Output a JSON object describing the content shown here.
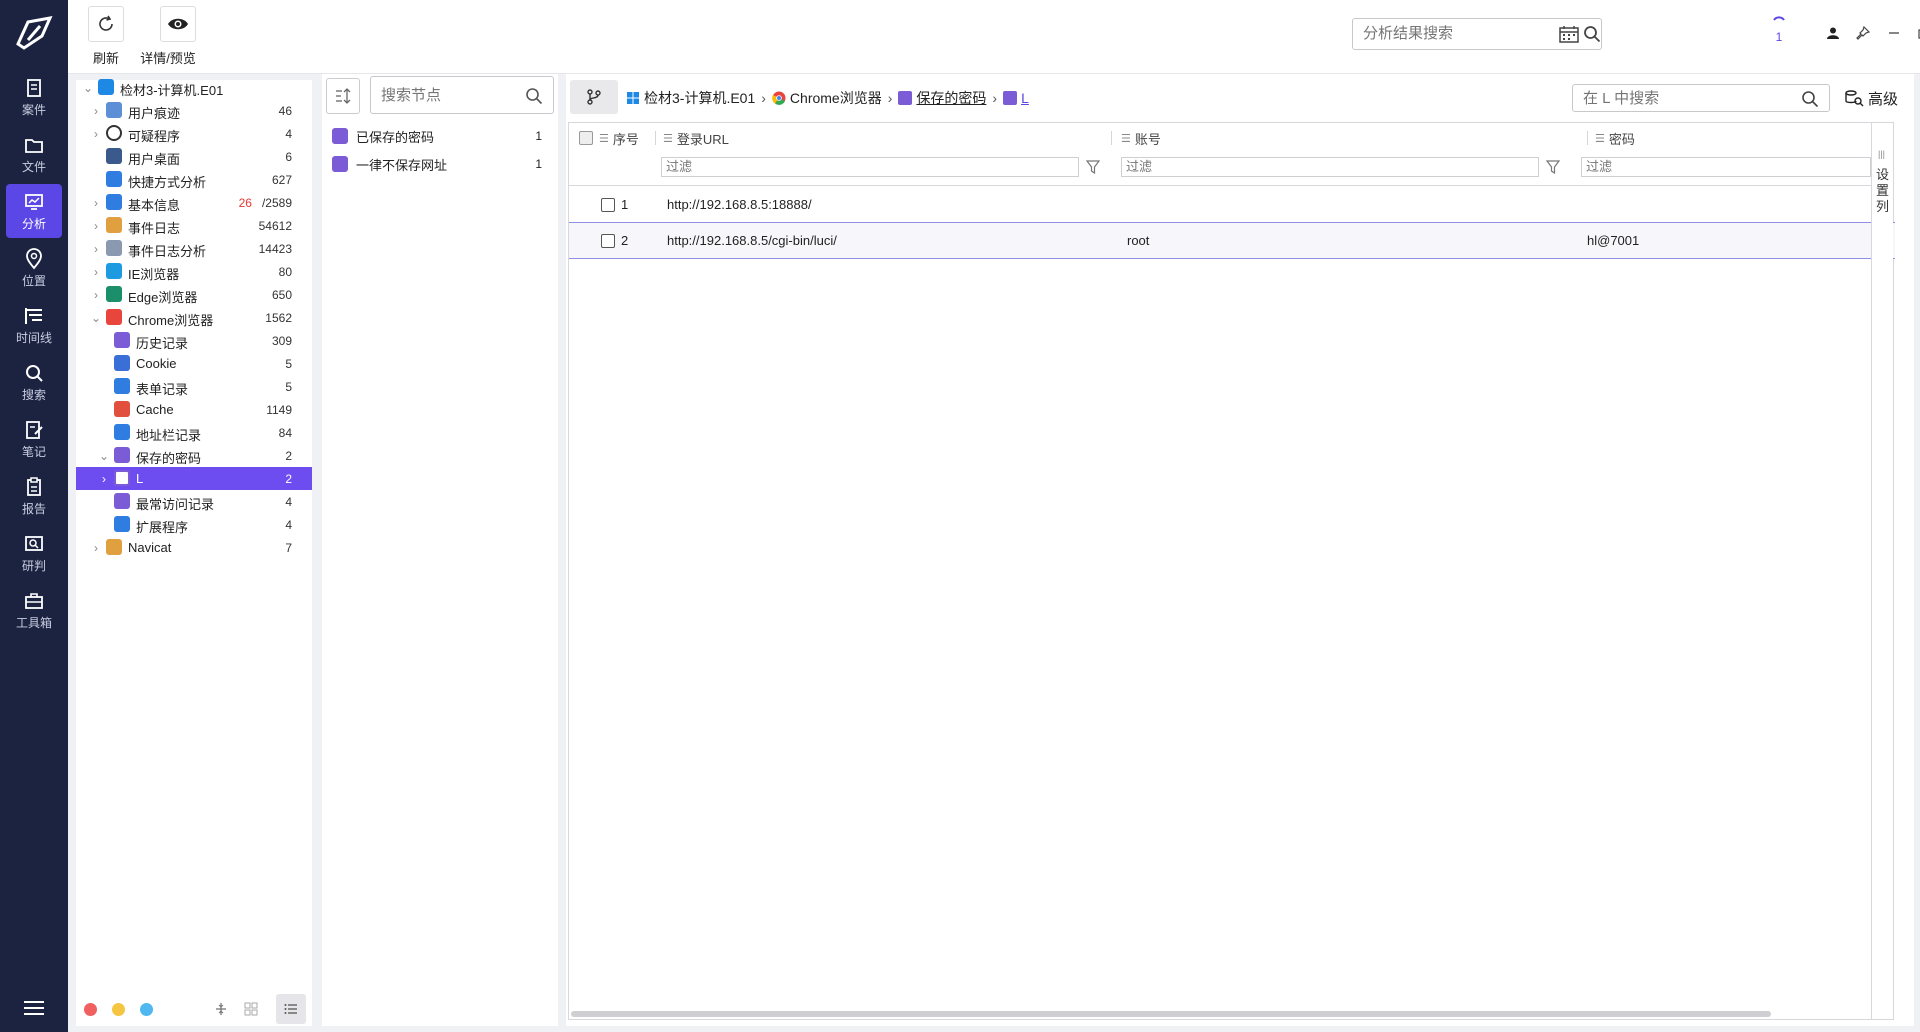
{
  "nav": {
    "items": [
      {
        "label": "案件",
        "icon": "case-icon"
      },
      {
        "label": "文件",
        "icon": "folder-icon"
      },
      {
        "label": "分析",
        "icon": "analysis-icon"
      },
      {
        "label": "位置",
        "icon": "location-pin-icon"
      },
      {
        "label": "时间线",
        "icon": "timeline-icon"
      },
      {
        "label": "搜索",
        "icon": "search-icon"
      },
      {
        "label": "笔记",
        "icon": "note-icon"
      },
      {
        "label": "报告",
        "icon": "report-icon"
      },
      {
        "label": "研判",
        "icon": "judgement-icon"
      },
      {
        "label": "工具箱",
        "icon": "toolbox-icon"
      }
    ],
    "active": "分析"
  },
  "toolbar": {
    "refresh_label": "刷新",
    "preview_label": "详情/预览",
    "search_placeholder": "分析结果搜索",
    "task_count": "1"
  },
  "tree": {
    "items": [
      {
        "label": "检材3-计算机.E01",
        "count": "",
        "icon": "windows-icon",
        "color": "#1e88e5"
      },
      {
        "label": "用户痕迹",
        "count": "46",
        "icon": "user-trace-icon",
        "color": "#5c8fd6"
      },
      {
        "label": "可疑程序",
        "count": "4",
        "icon": "magnifier-icon",
        "color": "#333333"
      },
      {
        "label": "用户桌面",
        "count": "6",
        "icon": "desktop-icon",
        "color": "#3a5a8c"
      },
      {
        "label": "快捷方式分析",
        "count": "627",
        "icon": "shortcut-icon",
        "color": "#2f7de1"
      },
      {
        "label": "基本信息",
        "count_red": "26",
        "count": "/2589",
        "icon": "info-icon",
        "color": "#2f7de1"
      },
      {
        "label": "事件日志",
        "count": "54612",
        "icon": "event-log-icon",
        "color": "#e0a040"
      },
      {
        "label": "事件日志分析",
        "count": "14423",
        "icon": "event-log-analysis-icon",
        "color": "#8a98b0"
      },
      {
        "label": "IE浏览器",
        "count": "80",
        "icon": "ie-icon",
        "color": "#1e9be0"
      },
      {
        "label": "Edge浏览器",
        "count": "650",
        "icon": "edge-icon",
        "color": "#1b8f6a"
      },
      {
        "label": "Chrome浏览器",
        "count": "1562",
        "icon": "chrome-icon",
        "color": "#e8453c"
      },
      {
        "label": "历史记录",
        "count": "309",
        "icon": "history-icon",
        "color": "#7b5cd6"
      },
      {
        "label": "Cookie",
        "count": "5",
        "icon": "cookie-icon",
        "color": "#3b6fd8"
      },
      {
        "label": "表单记录",
        "count": "5",
        "icon": "form-icon",
        "color": "#2f7de1"
      },
      {
        "label": "Cache",
        "count": "1149",
        "icon": "cache-icon",
        "color": "#e0503c"
      },
      {
        "label": "地址栏记录",
        "count": "84",
        "icon": "address-bar-icon",
        "color": "#2f7de1"
      },
      {
        "label": "保存的密码",
        "count": "2",
        "icon": "password-icon",
        "color": "#7b5cd6"
      },
      {
        "label": "L",
        "count": "2",
        "icon": "password-icon",
        "color": "#7b5cd6"
      },
      {
        "label": "最常访问记录",
        "count": "4",
        "icon": "most-visited-icon",
        "color": "#7b5cd6"
      },
      {
        "label": "扩展程序",
        "count": "4",
        "icon": "extension-icon",
        "color": "#2f7de1"
      },
      {
        "label": "Navicat",
        "count": "7",
        "icon": "navicat-icon",
        "color": "#e0a040"
      }
    ]
  },
  "nodes": {
    "search_placeholder": "搜索节点",
    "items": [
      {
        "label": "已保存的密码",
        "count": "1"
      },
      {
        "label": "一律不保存网址",
        "count": "1"
      }
    ]
  },
  "breadcrumb": [
    "检材3-计算机.E01",
    "Chrome浏览器",
    "保存的密码",
    "L"
  ],
  "main": {
    "search_placeholder": "在 L 中搜索",
    "advanced_label": "高级",
    "settings_label": "设置列"
  },
  "table": {
    "columns": [
      "序号",
      "登录URL",
      "账号",
      "密码"
    ],
    "filter_placeholder": "过滤",
    "rows": [
      {
        "index": "1",
        "url": "http://192.168.8.5:18888/",
        "account": "",
        "password": ""
      },
      {
        "index": "2",
        "url": "http://192.168.8.5/cgi-bin/luci/",
        "account": "root",
        "password": "hl@7001"
      }
    ]
  },
  "colors": {
    "sidebar_bg": "#1c2341",
    "accent": "#5b46e6",
    "selected_row": "#6e4df0"
  }
}
